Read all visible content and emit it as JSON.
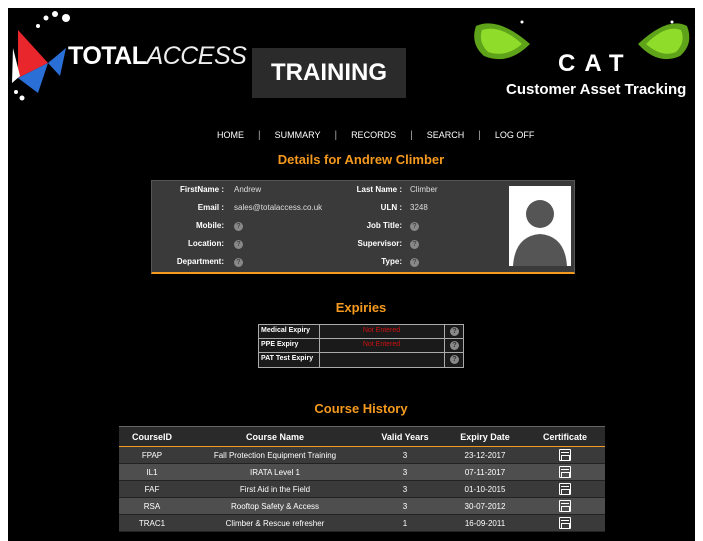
{
  "header": {
    "logo_bold": "TOTAL",
    "logo_thin": "ACCESS",
    "page_title": "TRAINING",
    "cat_title": "CAT",
    "cat_subtitle": "Customer Asset Tracking"
  },
  "nav": [
    "HOME",
    "SUMMARY",
    "RECORDS",
    "SEARCH",
    "LOG OFF"
  ],
  "details": {
    "heading": "Details for Andrew Climber",
    "first_name_label": "FirstName :",
    "first_name": "Andrew",
    "last_name_label": "Last Name :",
    "last_name": "Climber",
    "email_label": "Email :",
    "email": "sales@totalaccess.co.uk",
    "uln_label": "ULN :",
    "uln": "3248",
    "mobile_label": "Mobile:",
    "job_title_label": "Job Title:",
    "location_label": "Location:",
    "supervisor_label": "Supervisor:",
    "department_label": "Department:",
    "type_label": "Type:"
  },
  "expiries": {
    "heading": "Expiries",
    "rows": [
      {
        "label": "Medical Expiry",
        "value": "Not Entered"
      },
      {
        "label": "PPE Expiry",
        "value": "Not Entered"
      },
      {
        "label": "PAT Test Expiry",
        "value": ""
      }
    ]
  },
  "course_history": {
    "heading": "Course History",
    "columns": [
      "CourseID",
      "Course Name",
      "Valid Years",
      "Expiry Date",
      "Certificate"
    ],
    "rows": [
      {
        "id": "FPAP",
        "name": "Fall Protection Equipment Training",
        "years": "3",
        "expiry": "23-12-2017"
      },
      {
        "id": "IL1",
        "name": "IRATA Level 1",
        "years": "3",
        "expiry": "07-11-2017"
      },
      {
        "id": "FAF",
        "name": "First Aid in the Field",
        "years": "3",
        "expiry": "01-10-2015"
      },
      {
        "id": "RSA",
        "name": "Rooftop Safety & Access",
        "years": "3",
        "expiry": "30-07-2012"
      },
      {
        "id": "TRAC1",
        "name": "Climber & Rescue refresher",
        "years": "1",
        "expiry": "16-09-2011"
      }
    ]
  },
  "colors": {
    "accent": "#f59a1e",
    "expiry_red": "#cc1111",
    "logo_red": "#e8262b",
    "logo_blue": "#2a6fd6",
    "cat_eye_green": "#7ed321"
  },
  "icons": {
    "info": "question-circle-icon",
    "certificate": "certificate-document-icon"
  }
}
